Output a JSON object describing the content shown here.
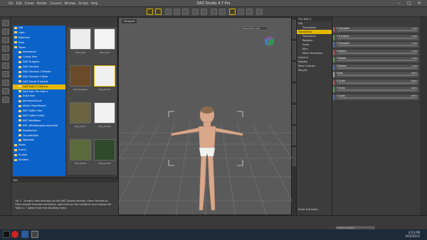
{
  "window": {
    "title": "DAZ Studio 4.7 Pro"
  },
  "menubar": [
    "File",
    "Edit",
    "Create",
    "Render",
    "Connect",
    "Window",
    "Scripts",
    "Help"
  ],
  "tree": {
    "items": [
      "Hat",
      "Light",
      "Materials",
      "Pose",
      "Poses",
      "Interactive",
      "Crying Tree",
      "DAZ Dragons",
      "DAZ Genesis",
      "DAZ Genesis 2 Female",
      "DAZ Genesis 2 Male",
      "DAZ Studio Tutorials",
      "DAZ Kids 4 Clothing",
      "DAZ Kids The Kids 4",
      "Dusk Hair",
      "Journeys/Scout",
      "Kalahr Sweatheart",
      "KNT Gaffer Hair",
      "KNT Gaffer Outfit",
      "KNT WildWave",
      "KNT_WildWaveJourneyOutfit",
      "KidsWarrior",
      "ThunderKids",
      "Walkable",
      "Poses",
      "Scene",
      "Scripts",
      "Shaders"
    ],
    "selected_index": 12
  },
  "thumbs": [
    {
      "label": "Kids_Tank"
    },
    {
      "label": "Kids_Shirt"
    },
    {
      "label": "Kids_Sweater"
    },
    {
      "label": "Kids_Shirt2"
    },
    {
      "label": "Kids_Camo"
    },
    {
      "label": "Kids_Shorts"
    },
    {
      "label": "Kids_Tank2"
    },
    {
      "label": "Kids_Jacket"
    }
  ],
  "tips": {
    "tab": "Tips",
    "text": "Tip 1 - To add a root directory to the DAZ Studio Formats, Poser Formats or Other Import Formats containers, right-click on the container and choose the \"Add a...\" option from the resulting menu.",
    "bottom_tab": "Tools | Content Library"
  },
  "viewport": {
    "tab": "Viewport",
    "camera": "Perspective View"
  },
  "scene": {
    "header": "The Kids 4",
    "items": [
      "Hip",
      "Translation",
      "Transforms",
      "Translation",
      "Rotation",
      "Scale",
      "Misc",
      "Mesh Resolution",
      "General",
      "Display",
      "Pose Controls",
      "Morphs"
    ],
    "selected_index": 2,
    "checkbox": "Show Sub Items"
  },
  "params": [
    {
      "label": "X Translate",
      "value": "0.00"
    },
    {
      "label": "Y Translate",
      "value": "0.00"
    },
    {
      "label": "Z Translate",
      "value": "0.00"
    },
    {
      "label": "X Rotate",
      "value": "0.00"
    },
    {
      "label": "Y Rotate",
      "value": "0.00"
    },
    {
      "label": "Z Rotate",
      "value": "0.00"
    },
    {
      "label": "Scale",
      "value": "100%"
    },
    {
      "label": "X Scale",
      "value": "100%"
    },
    {
      "label": "Y Scale",
      "value": "100%"
    },
    {
      "label": "Z Scale",
      "value": "100%"
    }
  ],
  "status": {
    "search_placeholder": "Enter a Lesson...",
    "tab": "Lessons"
  },
  "taskbar": {
    "time": "4:53 PM",
    "date": "4/23/2015"
  },
  "colors": {
    "accent": "#e4b800",
    "tree_bg": "#0b62c9"
  }
}
